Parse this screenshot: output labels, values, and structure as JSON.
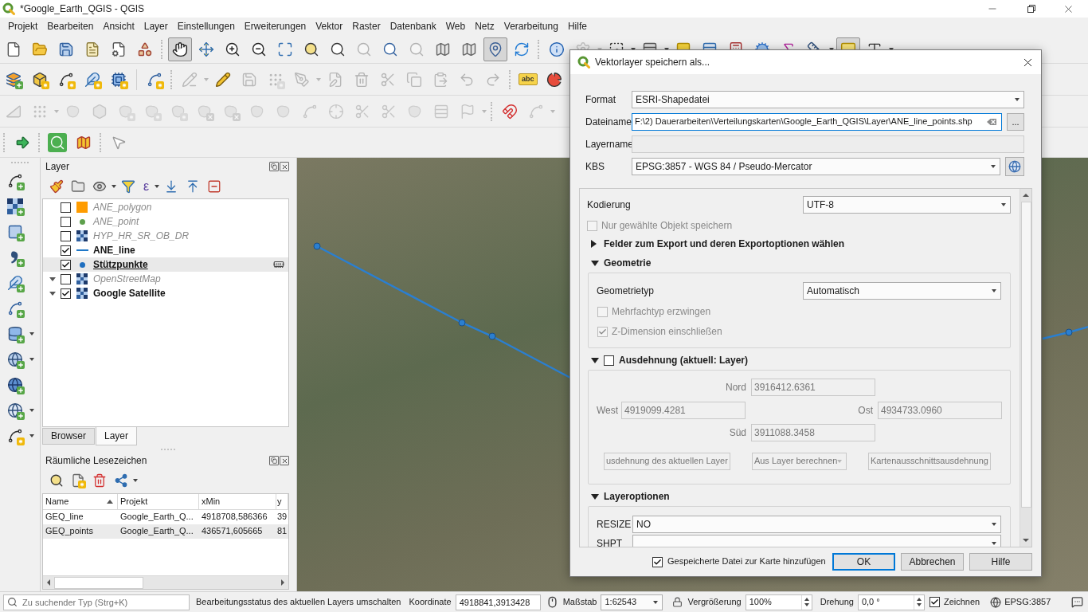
{
  "window": {
    "title": "*Google_Earth_QGIS - QGIS"
  },
  "menu": [
    "Projekt",
    "Bearbeiten",
    "Ansicht",
    "Layer",
    "Einstellungen",
    "Erweiterungen",
    "Vektor",
    "Raster",
    "Datenbank",
    "Web",
    "Netz",
    "Verarbeitung",
    "Hilfe"
  ],
  "toolbars": [
    [
      {
        "pressed": false,
        "disabled": false
      },
      {
        "pressed": false,
        "disabled": false
      },
      {
        "pressed": false,
        "disabled": false
      },
      {
        "pressed": false,
        "disabled": false
      },
      {
        "pressed": false,
        "disabled": false
      },
      {
        "pressed": false,
        "disabled": false
      },
      {
        "pressed": true,
        "disabled": false
      },
      {
        "pressed": false,
        "disabled": false
      },
      {
        "pressed": false,
        "disabled": false
      },
      {
        "pressed": false,
        "disabled": false
      },
      {
        "pressed": false,
        "disabled": false
      },
      {
        "pressed": false,
        "disabled": false
      },
      {
        "pressed": false,
        "disabled": false
      },
      {
        "pressed": false,
        "disabled": true
      },
      {
        "pressed": false,
        "disabled": false
      },
      {
        "pressed": false,
        "disabled": true
      },
      {
        "pressed": false,
        "disabled": false
      },
      {
        "pressed": false,
        "disabled": false
      },
      {
        "pressed": true,
        "disabled": false
      },
      {
        "pressed": false,
        "disabled": false
      },
      {
        "pressed": false,
        "disabled": false
      },
      {
        "pressed": false,
        "disabled": true
      },
      {
        "pressed": false,
        "disabled": false
      },
      {
        "pressed": false,
        "disabled": false
      },
      {
        "pressed": false,
        "disabled": false
      },
      {
        "pressed": false,
        "disabled": false
      },
      {
        "pressed": false,
        "disabled": false
      },
      {
        "pressed": false,
        "disabled": false
      },
      {
        "pressed": false,
        "disabled": false
      },
      {
        "pressed": false,
        "disabled": false
      },
      {
        "pressed": true,
        "disabled": false
      },
      {
        "pressed": false,
        "disabled": false
      }
    ],
    [
      {
        "disabled": false
      },
      {
        "disabled": false
      },
      {
        "disabled": false
      },
      {
        "disabled": false
      },
      {
        "disabled": false
      },
      {
        "disabled": false
      },
      {
        "disabled": true
      },
      {
        "disabled": false
      },
      {
        "disabled": true
      },
      {
        "disabled": true
      },
      {
        "disabled": true
      },
      {
        "disabled": true
      },
      {
        "disabled": true
      },
      {
        "disabled": true
      },
      {
        "disabled": true
      },
      {
        "disabled": true
      },
      {
        "disabled": true
      },
      {
        "disabled": true
      },
      {
        "disabled": false,
        "text": "abc"
      },
      {
        "disabled": false
      }
    ],
    [
      {
        "disabled": true
      },
      {
        "disabled": true
      },
      {
        "disabled": true
      },
      {
        "disabled": true
      },
      {
        "disabled": true
      },
      {
        "disabled": true
      },
      {
        "disabled": true
      },
      {
        "disabled": true
      },
      {
        "disabled": true
      },
      {
        "disabled": true
      },
      {
        "disabled": true
      },
      {
        "disabled": true
      },
      {
        "disabled": true
      },
      {
        "disabled": true
      },
      {
        "disabled": true
      },
      {
        "disabled": true
      },
      {
        "disabled": true
      },
      {
        "disabled": true
      },
      {
        "disabled": false
      },
      {
        "disabled": true
      }
    ]
  ],
  "layers_panel": {
    "title": "Layer",
    "expression_button": "ε",
    "layers": [
      {
        "name": "ANE_polygon",
        "checked": false,
        "selected": false,
        "temporary": false,
        "symbol": {
          "kind": "polygon",
          "color": "#ff9c00"
        }
      },
      {
        "name": "ANE_point",
        "checked": false,
        "selected": false,
        "temporary": false,
        "symbol": {
          "kind": "point",
          "color": "#5ea04c"
        }
      },
      {
        "name": "HYP_HR_SR_OB_DR",
        "checked": false,
        "selected": false,
        "temporary": false,
        "symbol": {
          "kind": "raster"
        }
      },
      {
        "name": "ANE_line",
        "checked": true,
        "selected": false,
        "temporary": false,
        "symbol": {
          "kind": "line",
          "color": "#1f78c8"
        }
      },
      {
        "name": "Stützpunkte",
        "checked": true,
        "selected": true,
        "temporary": true,
        "symbol": {
          "kind": "point",
          "color": "#1f6fc0"
        }
      },
      {
        "name": "OpenStreetMap",
        "checked": false,
        "selected": false,
        "temporary": false,
        "expanded": true,
        "symbol": {
          "kind": "raster"
        }
      },
      {
        "name": "Google Satellite",
        "checked": true,
        "selected": false,
        "temporary": false,
        "expanded": true,
        "symbol": {
          "kind": "raster"
        }
      }
    ],
    "tabs": [
      {
        "label": "Browser",
        "selected": false
      },
      {
        "label": "Layer",
        "selected": true
      }
    ]
  },
  "bookmarks_panel": {
    "title": "Räumliche Lesezeichen",
    "columns": [
      {
        "label": "Name",
        "sorted": true
      },
      {
        "label": "Projekt",
        "sorted": false
      },
      {
        "label": "xMin",
        "sorted": false
      },
      {
        "label": "y",
        "sorted": false
      }
    ],
    "rows": [
      [
        "GEQ_line",
        "Google_Earth_Q...",
        "4918708,586366",
        "39"
      ],
      [
        "GEQ_points",
        "Google_Earth_Q...",
        "436571,605665",
        "81"
      ]
    ]
  },
  "dialog": {
    "title": "Vektorlayer speichern als...",
    "fields": [
      {
        "kind": "select",
        "label": "Format",
        "value": "ESRI-Shapedatei",
        "focused": false,
        "disabled": false
      },
      {
        "kind": "file",
        "label": "Dateiname",
        "value": "F:\\2) Dauerarbeiten\\Verteilungskarten\\Google_Earth_QGIS\\Layer\\ANE_line_points.shp",
        "button": "...",
        "focused": true,
        "disabled": false
      },
      {
        "kind": "text",
        "label": "Layername",
        "focused": false,
        "disabled": true
      },
      {
        "kind": "crs",
        "label": "KBS",
        "value": "EPSG:3857 - WGS 84 / Pseudo-Mercator",
        "focused": false,
        "disabled": false
      }
    ],
    "encoding": {
      "label": "Kodierung",
      "value": "UTF-8"
    },
    "selected_only": {
      "label": "Nur gewählte Objekt speichern",
      "checked": false,
      "disabled": true
    },
    "sections": [
      {
        "kind": "fields",
        "title": "Felder zum Export und deren Exportoptionen wählen",
        "expanded": false
      },
      {
        "kind": "geometry",
        "title": "Geometrie",
        "expanded": true,
        "type": {
          "label": "Geometrietyp",
          "value": "Automatisch"
        },
        "options": [
          {
            "label": "Mehrfachtyp erzwingen",
            "checked": false,
            "disabled": true
          },
          {
            "label": "Z-Dimension einschließen",
            "checked": true,
            "disabled": true
          }
        ]
      },
      {
        "kind": "extent",
        "title": "Ausdehnung (aktuell: Layer)",
        "expanded": true,
        "checked": false,
        "north": {
          "label": "Nord",
          "value": "3916412.6361"
        },
        "west": {
          "label": "West",
          "value": "4919099.4281"
        },
        "east": {
          "label": "Ost",
          "value": "4934733.0960"
        },
        "south": {
          "label": "Süd",
          "value": "3911088.3458"
        },
        "buttons": [
          {
            "label": "usdehnung des aktuellen Layer",
            "dropdown": false
          },
          {
            "label": "Aus Layer berechnen",
            "dropdown": true
          },
          {
            "label": "Kartenausschnittsausdehnung",
            "dropdown": false
          }
        ]
      },
      {
        "kind": "layer_options",
        "title": "Layeroptionen",
        "expanded": true,
        "options": [
          {
            "label": "RESIZE",
            "value": "NO"
          },
          {
            "label": "SHPT"
          }
        ]
      }
    ],
    "add_to_map": {
      "label": "Gespeicherte Datei zur Karte hinzufügen",
      "checked": true
    },
    "buttons": [
      {
        "label": "OK",
        "default": true
      },
      {
        "label": "Abbrechen",
        "default": false
      },
      {
        "label": "Hilfe",
        "default": false
      }
    ]
  },
  "status_bar": {
    "search_placeholder": "Zu suchender Typ (Strg+K)",
    "message": "Bearbeitungsstatus des aktuellen Layers umschalten",
    "coordinate": {
      "label": "Koordinate",
      "value": "4918841,3913428"
    },
    "scale": {
      "label": "Maßstab",
      "value": "1:62543"
    },
    "magnifier": {
      "label": "Vergrößerung",
      "value": "100%"
    },
    "rotation": {
      "label": "Drehung",
      "value": "0,0 °"
    },
    "render": {
      "label": "Zeichnen",
      "checked": true
    },
    "crs": "EPSG:3857"
  }
}
